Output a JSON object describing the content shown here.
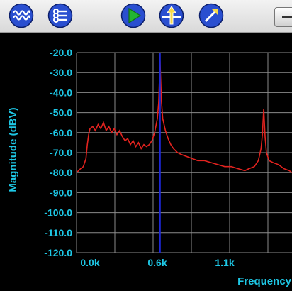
{
  "toolbar": {
    "buttons": [
      {
        "name": "fft-waveform-button",
        "icon": "waveform-icon"
      },
      {
        "name": "settings-button",
        "icon": "settings-sliders-icon"
      },
      {
        "name": "play-button",
        "icon": "play-icon"
      },
      {
        "name": "marker-button",
        "icon": "marker-arrow-icon"
      },
      {
        "name": "autoscale-button",
        "icon": "diagonal-arrow-icon"
      }
    ],
    "accent_blue": "#2a4fd0",
    "play_green": "#22b531"
  },
  "plot": {
    "bg_color": "#000000",
    "grid_color": "#8a8a8a",
    "label_color": "#1ec8e6",
    "trace_color": "#e2231f",
    "marker_color": "#1d27d6",
    "marker_freq_label": "Frequency"
  },
  "chart_data": {
    "type": "line",
    "xlabel": "Frequency",
    "ylabel": "Magnitude (dBV)",
    "ylim": [
      -120,
      -20
    ],
    "ytick_labels": [
      "-20.0",
      "-30.0",
      "-40.0",
      "-50.0",
      "-60.0",
      "-70.0",
      "-80.0",
      "-90.0",
      "-100.0",
      "-110.0",
      "-120.0"
    ],
    "xtick_labels": [
      "0.0k",
      "0.6k",
      "1.1k"
    ],
    "xtick_values": [
      0.1,
      0.6,
      1.1
    ],
    "x_visible_range": [
      0.0,
      1.6
    ],
    "marker_x": 0.62,
    "grid": true,
    "series": [
      {
        "points": [
          [
            0.0,
            -80
          ],
          [
            0.03,
            -78
          ],
          [
            0.05,
            -77
          ],
          [
            0.07,
            -73
          ],
          [
            0.08,
            -66
          ],
          [
            0.09,
            -61
          ],
          [
            0.1,
            -58
          ],
          [
            0.12,
            -57
          ],
          [
            0.14,
            -59
          ],
          [
            0.16,
            -56
          ],
          [
            0.18,
            -58
          ],
          [
            0.2,
            -55
          ],
          [
            0.22,
            -59
          ],
          [
            0.24,
            -57
          ],
          [
            0.26,
            -60
          ],
          [
            0.28,
            -58
          ],
          [
            0.3,
            -61
          ],
          [
            0.32,
            -59
          ],
          [
            0.34,
            -62
          ],
          [
            0.36,
            -64
          ],
          [
            0.38,
            -63
          ],
          [
            0.4,
            -66
          ],
          [
            0.42,
            -64
          ],
          [
            0.44,
            -67
          ],
          [
            0.46,
            -65
          ],
          [
            0.48,
            -68
          ],
          [
            0.5,
            -66
          ],
          [
            0.52,
            -67
          ],
          [
            0.54,
            -66
          ],
          [
            0.56,
            -64
          ],
          [
            0.58,
            -60
          ],
          [
            0.6,
            -53
          ],
          [
            0.61,
            -45
          ],
          [
            0.62,
            -24
          ],
          [
            0.63,
            -44
          ],
          [
            0.64,
            -53
          ],
          [
            0.66,
            -59
          ],
          [
            0.68,
            -63
          ],
          [
            0.7,
            -66
          ],
          [
            0.72,
            -68
          ],
          [
            0.75,
            -70
          ],
          [
            0.78,
            -71
          ],
          [
            0.82,
            -72
          ],
          [
            0.86,
            -73
          ],
          [
            0.9,
            -74
          ],
          [
            0.95,
            -74
          ],
          [
            1.0,
            -75
          ],
          [
            1.05,
            -76
          ],
          [
            1.1,
            -77
          ],
          [
            1.15,
            -77
          ],
          [
            1.2,
            -78
          ],
          [
            1.25,
            -79
          ],
          [
            1.28,
            -78
          ],
          [
            1.32,
            -77
          ],
          [
            1.35,
            -74
          ],
          [
            1.37,
            -68
          ],
          [
            1.38,
            -61
          ],
          [
            1.39,
            -48
          ],
          [
            1.4,
            -62
          ],
          [
            1.41,
            -70
          ],
          [
            1.43,
            -74
          ],
          [
            1.46,
            -75
          ],
          [
            1.5,
            -76
          ],
          [
            1.54,
            -78
          ],
          [
            1.58,
            -79
          ],
          [
            1.6,
            -80
          ]
        ]
      }
    ]
  }
}
